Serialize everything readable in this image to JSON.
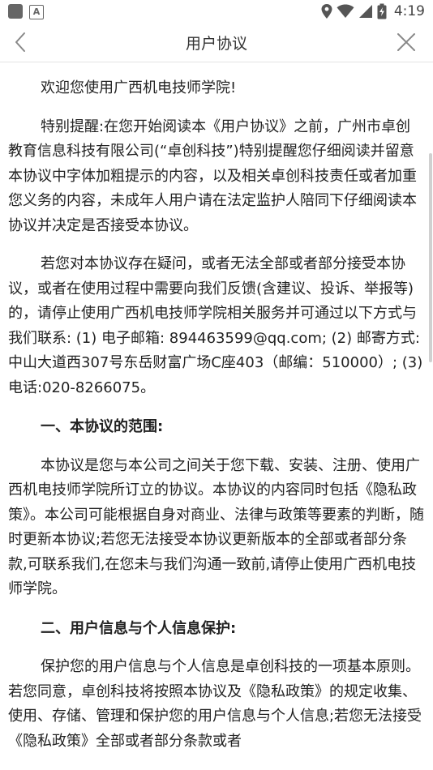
{
  "status_bar": {
    "time": "4:19",
    "icons": [
      "notification-square-icon",
      "a-app-icon",
      "location-icon",
      "wifi-icon",
      "signal-icon",
      "battery-charging-icon"
    ]
  },
  "nav": {
    "title": "用户协议",
    "back_icon": "chevron-left-icon",
    "close_icon": "close-icon"
  },
  "agreement": {
    "greeting": "欢迎您使用广西机电技师学院!",
    "intro": "特别提醒:在您开始阅读本《用户协议》之前，广州市卓创教育信息科技有限公司(“卓创科技”)特别提醒您仔细阅读并留意本协议中字体加粗提示的内容，以及相关卓创科技责任或者加重您义务的内容，未成年人用户请在法定监护人陪同下仔细阅读本协议并决定是否接受本协议。",
    "contact": "若您对本协议存在疑问，或者无法全部或者部分接受本协议，或者在使用过程中需要向我们反馈(含建议、投诉、举报等)的，请停止使用广西机电技师学院相关服务并可通过以下方式与我们联系: (1) 电子邮箱: 894463599@qq.com; (2) 邮寄方式: 中山大道西307号东岳财富广场C座403（邮编：510000）; (3) 电话:020-8266075。",
    "section1_title": "一、本协议的范围:",
    "section1_body": "本协议是您与本公司之间关于您下载、安装、注册、使用广西机电技师学院所订立的协议。本协议的内容同时包括《隐私政策》。本公司可能根据自身对商业、法律与政策等要素的判断，随时更新本协议;若您无法接受本协议更新版本的全部或者部分条款,可联系我们,在您未与我们沟通一致前,请停止使用广西机电技师学院。",
    "section2_title": "二、用户信息与个人信息保护:",
    "section2_body": "保护您的用户信息与个人信息是卓创科技的一项基本原则。若您同意，卓创科技将按照本协议及《隐私政策》的规定收集、使用、存储、管理和保护您的用户信息与个人信息;若您无法接受《隐私政策》全部或者部分条款或者"
  }
}
